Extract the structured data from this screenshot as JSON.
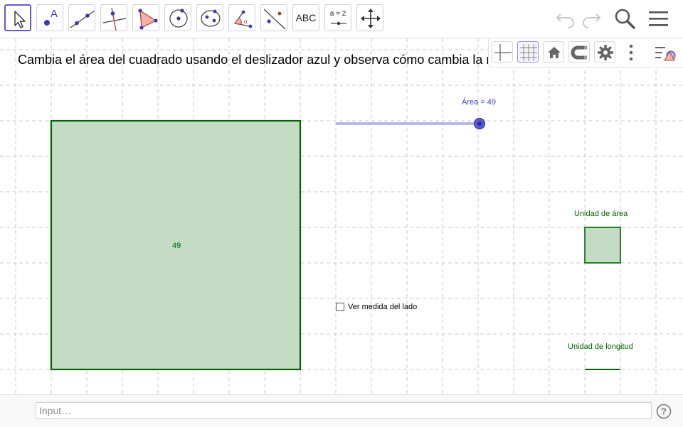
{
  "toolbar": {
    "tools": [
      {
        "name": "move-tool",
        "icon": "arrow-pointer-icon"
      },
      {
        "name": "point-tool",
        "icon": "point-icon"
      },
      {
        "name": "line-tool",
        "icon": "line-through-two-points-icon"
      },
      {
        "name": "perpendicular-line-tool",
        "icon": "perpendicular-line-icon"
      },
      {
        "name": "polygon-tool",
        "icon": "polygon-icon"
      },
      {
        "name": "circle-tool",
        "icon": "circle-with-center-icon"
      },
      {
        "name": "ellipse-tool",
        "icon": "ellipse-icon"
      },
      {
        "name": "angle-tool",
        "icon": "angle-icon"
      },
      {
        "name": "reflect-tool",
        "icon": "reflect-about-line-icon"
      },
      {
        "name": "text-tool",
        "label": "ABC"
      },
      {
        "name": "slider-tool",
        "label": "a = 2"
      },
      {
        "name": "move-graphics-view-tool",
        "icon": "move-view-icon"
      }
    ],
    "point_label": "A",
    "text_tool_label": "ABC",
    "slider_tool_label": "a = 2"
  },
  "instruction": "Cambia el área del cuadrado usando el deslizador azul y observa cómo cambia la m",
  "slider": {
    "label": "Área = 49",
    "value": 49,
    "color": "#3f3fc0"
  },
  "square": {
    "area": 49,
    "label": "49",
    "fill": "#c3dcc3",
    "stroke": "#006400"
  },
  "checkbox": {
    "label": "Ver medida del lado",
    "checked": false
  },
  "unit_area": {
    "label": "Unidad de área"
  },
  "unit_length": {
    "label": "Unidad de longitud"
  },
  "input_bar": {
    "placeholder": "Input…"
  },
  "colors": {
    "accent": "#6557d2",
    "dark_green": "#006400",
    "slider_blue": "#3f3fc0"
  }
}
